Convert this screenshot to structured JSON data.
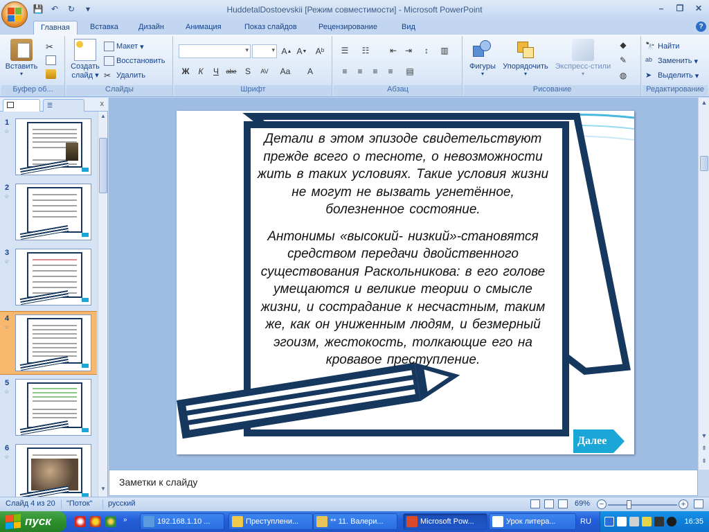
{
  "window": {
    "title": "HuddetalDostoevskii [Режим совместимости] - Microsoft PowerPoint"
  },
  "ribbon": {
    "tabs": [
      "Главная",
      "Вставка",
      "Дизайн",
      "Анимация",
      "Показ слайдов",
      "Рецензирование",
      "Вид"
    ],
    "active_tab": "Главная",
    "groups": {
      "clipboard": {
        "label": "Буфер об...",
        "paste": "Вставить"
      },
      "slides": {
        "label": "Слайды",
        "create": "Создать",
        "create2": "слайд",
        "layout": "Макет",
        "reset": "Восстановить",
        "delete": "Удалить"
      },
      "font": {
        "label": "Шрифт"
      },
      "paragraph": {
        "label": "Абзац"
      },
      "drawing": {
        "label": "Рисование",
        "shapes": "Фигуры",
        "arrange": "Упорядочить",
        "quick_styles": "Экспресс-стили"
      },
      "editing": {
        "label": "Редактирование",
        "find": "Найти",
        "replace": "Заменить",
        "select": "Выделить"
      }
    }
  },
  "slides_pane": {
    "thumbnails": [
      {
        "num": "1"
      },
      {
        "num": "2"
      },
      {
        "num": "3"
      },
      {
        "num": "4",
        "selected": true
      },
      {
        "num": "5"
      },
      {
        "num": "6"
      }
    ]
  },
  "slide": {
    "paragraph1": "Детали в этом эпизоде свидетельствуют прежде всего о тесноте, о невозможности жить в таких условиях. Такие условия жизни не могут не вызвать угнетённое, болезненное состояние.",
    "paragraph2": "Антонимы «высокий- низкий»-становятся средством передачи двойственного существования Раскольникова: в его голове умещаются и великие теории о смысле жизни, и сострадание к несчастным, таким же, как он униженным людям, и безмерный эгоизм, жестокость, толкающие его на кровавое преступление.",
    "next_button": "Далее"
  },
  "notes": {
    "placeholder": "Заметки к слайду"
  },
  "status": {
    "slide_info": "Слайд 4 из 20",
    "theme": "\"Поток\"",
    "language": "русский",
    "zoom": "69%"
  },
  "taskbar": {
    "start": "пуск",
    "items": [
      "192.168.1.10 ...",
      "Преступлени...",
      "** 11. Валери...",
      "Microsoft Pow...",
      "Урок литера..."
    ],
    "active_index": 3,
    "lang": "RU",
    "clock": "16:35"
  },
  "colors": {
    "accent": "#16375e",
    "next_button": "#1aa6d6",
    "selection": "#f8b96e"
  }
}
